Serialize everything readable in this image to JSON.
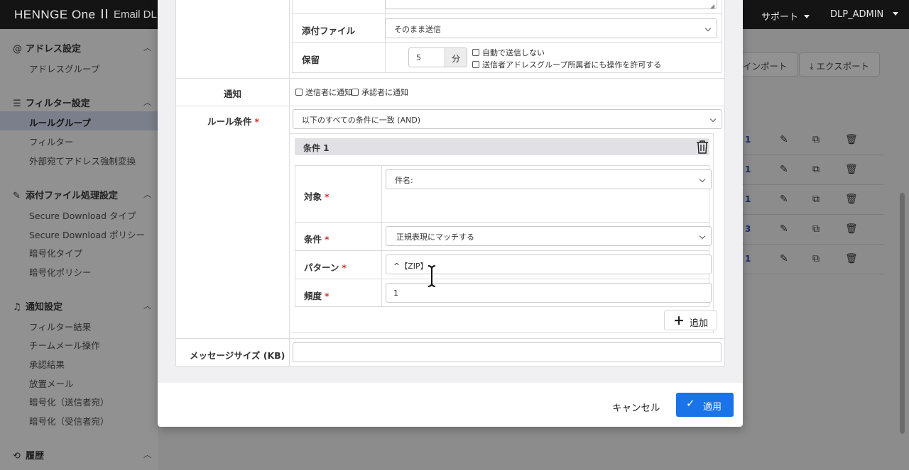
{
  "header": {
    "logo": "HENNGE One",
    "product": "Email DLP",
    "support": "サポート",
    "user": "DLP_ADMIN"
  },
  "sidebar": {
    "sections": [
      {
        "icon": "at-icon",
        "title": "アドレス設定",
        "items": [
          "アドレスグループ"
        ]
      },
      {
        "icon": "filter-icon",
        "title": "フィルター設定",
        "items": [
          "ルールグループ",
          "フィルター",
          "外部宛てアドレス強制変換"
        ],
        "active": "ルールグループ"
      },
      {
        "icon": "paperclip-icon",
        "title": "添付ファイル処理設定",
        "items": [
          "Secure Download タイプ",
          "Secure Download ポリシー",
          "暗号化タイプ",
          "暗号化ポリシー"
        ]
      },
      {
        "icon": "bell-icon",
        "title": "通知設定",
        "items": [
          "フィルター結果",
          "チームメール操作",
          "承認結果",
          "放置メール",
          "暗号化（送信者宛）",
          "暗号化（受信者宛）"
        ]
      },
      {
        "icon": "history-icon",
        "title": "履歴",
        "items": []
      }
    ]
  },
  "background": {
    "import_label": "インポート",
    "export_label": "エクスポート",
    "row_counts": [
      "1",
      "1",
      "1",
      "3",
      "1"
    ]
  },
  "form": {
    "attachment": {
      "label": "添付ファイル",
      "value": "そのまま送信"
    },
    "hold": {
      "label": "保留",
      "minutes": "5",
      "unit": "分",
      "no_auto_send": "自動で送信しない",
      "allow_sender_group": "送信者アドレスグループ所属者にも操作を許可する"
    },
    "notify": {
      "label": "通知",
      "notify_sender": "送信者に通知",
      "notify_approver": "承認者に通知"
    },
    "rule_condition": {
      "label": "ルール条件",
      "required": "*",
      "match_mode": "以下のすべての条件に一致 (AND)",
      "conditions": [
        {
          "title": "条件 1",
          "target_label": "対象",
          "target_value": "件名:",
          "condition_label": "条件",
          "condition_value": "正規表現にマッチする",
          "pattern_label": "パターン",
          "pattern_value": "^【ZIP】",
          "frequency_label": "頻度",
          "frequency_value": "1"
        }
      ],
      "add_label": "追加"
    },
    "message_size": {
      "label": "メッセージサイズ (KB)",
      "value": ""
    }
  },
  "footer": {
    "cancel_label": "キャンセル",
    "apply_label": "適用"
  }
}
